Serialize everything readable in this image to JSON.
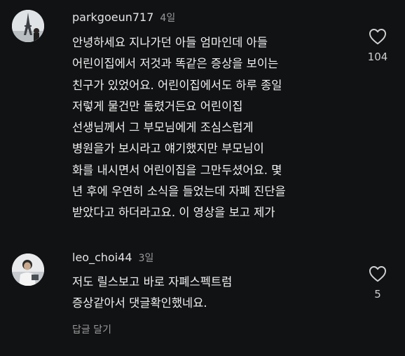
{
  "comments": [
    {
      "username": "parkgoeun717",
      "time": "4일",
      "lines": [
        "안녕하세요 지나가던 아들 엄마인데 아들",
        "어린이집에서 저것과 똑같은 증상을 보이는",
        "친구가 있었어요. 어린이집에서도 하루 종일",
        "저렇게 물건만 돌렸거든요 어린이집",
        "선생님께서 그 부모님에게 조심스럽게",
        "병원을가 보시라고 얘기했지만 부모님이",
        "화를 내시면서 어린이집을 그만두셨어요. 몇",
        "년 후에 우연히 소식을 들었는데 자폐 진단을",
        "받았다고 하더라고요. 이 영상을 보고 제가"
      ],
      "like_count": "104",
      "avatar_icon": "eiffel-tower-photo-icon",
      "like_icon": "heart-outline-icon"
    },
    {
      "username": "leo_choi44",
      "time": "3일",
      "lines": [
        "저도 릴스보고 바로 자폐스펙트럼",
        "증상같아서 댓글확인했네요."
      ],
      "like_count": "5",
      "avatar_icon": "person-photo-icon",
      "like_icon": "heart-outline-icon"
    }
  ],
  "reply_label": "답글 달기",
  "colors": {
    "background": "#111214",
    "text": "#f1f1f1",
    "muted": "#9a9a9a"
  }
}
